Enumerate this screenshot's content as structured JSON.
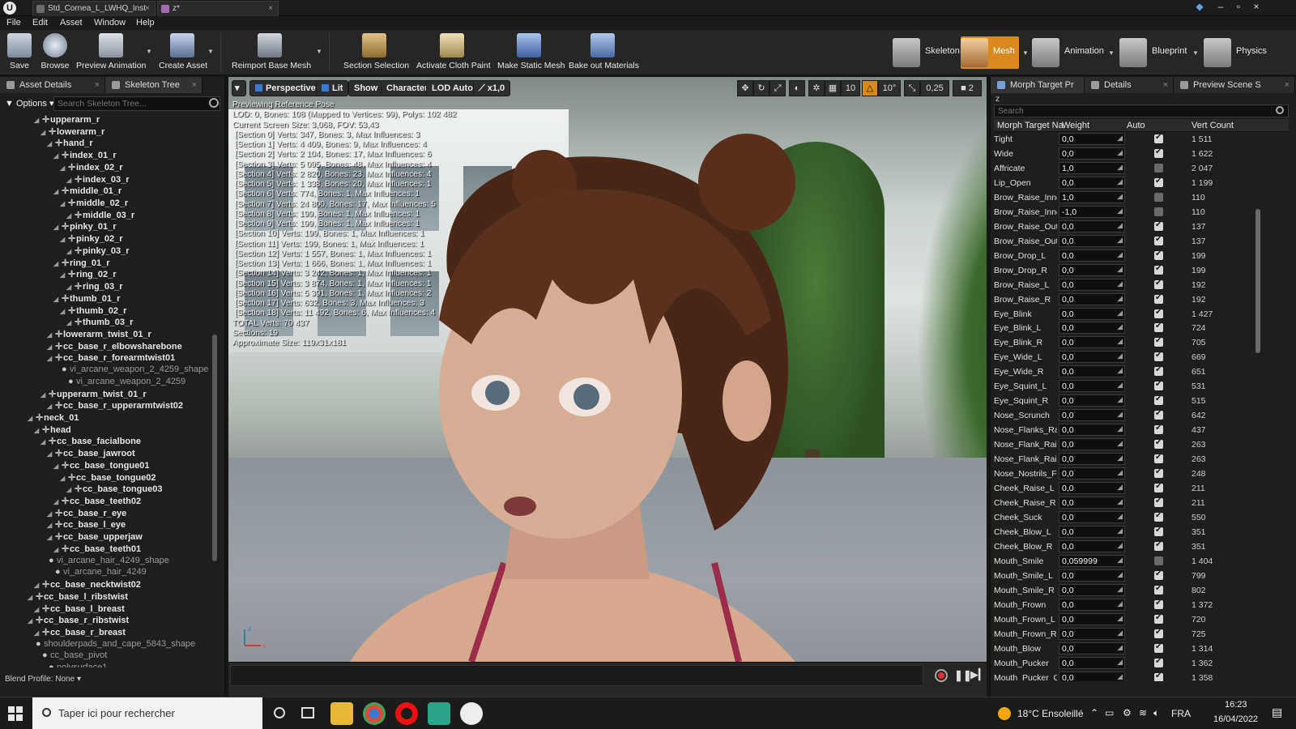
{
  "titlebar": {
    "tabs": [
      {
        "label": "Std_Cornea_L_LWHQ_Inst"
      },
      {
        "label": "z*"
      }
    ]
  },
  "menu": [
    "File",
    "Edit",
    "Asset",
    "Window",
    "Help"
  ],
  "toolbar": {
    "buttons": [
      "Save",
      "Browse",
      "Preview Animation",
      "Create Asset",
      "Reimport Base Mesh",
      "Section Selection",
      "Activate Cloth Paint",
      "Make Static Mesh",
      "Bake out Materials"
    ],
    "modes": [
      "Skeleton",
      "Mesh",
      "Animation",
      "Blueprint",
      "Physics"
    ]
  },
  "left_panel": {
    "tabs": [
      "Asset Details",
      "Skeleton Tree"
    ],
    "options_label": "Options",
    "search_placeholder": "Search Skeleton Tree...",
    "tree": [
      {
        "label": "upperarm_r",
        "depth": 4,
        "shape": false
      },
      {
        "label": "lowerarm_r",
        "depth": 5,
        "shape": false
      },
      {
        "label": "hand_r",
        "depth": 6,
        "shape": false
      },
      {
        "label": "index_01_r",
        "depth": 7,
        "shape": false
      },
      {
        "label": "index_02_r",
        "depth": 8,
        "shape": false
      },
      {
        "label": "index_03_r",
        "depth": 9,
        "shape": false
      },
      {
        "label": "middle_01_r",
        "depth": 7,
        "shape": false
      },
      {
        "label": "middle_02_r",
        "depth": 8,
        "shape": false
      },
      {
        "label": "middle_03_r",
        "depth": 9,
        "shape": false
      },
      {
        "label": "pinky_01_r",
        "depth": 7,
        "shape": false
      },
      {
        "label": "pinky_02_r",
        "depth": 8,
        "shape": false
      },
      {
        "label": "pinky_03_r",
        "depth": 9,
        "shape": false
      },
      {
        "label": "ring_01_r",
        "depth": 7,
        "shape": false
      },
      {
        "label": "ring_02_r",
        "depth": 8,
        "shape": false
      },
      {
        "label": "ring_03_r",
        "depth": 9,
        "shape": false
      },
      {
        "label": "thumb_01_r",
        "depth": 7,
        "shape": false
      },
      {
        "label": "thumb_02_r",
        "depth": 8,
        "shape": false
      },
      {
        "label": "thumb_03_r",
        "depth": 9,
        "shape": false
      },
      {
        "label": "lowerarm_twist_01_r",
        "depth": 6,
        "shape": false
      },
      {
        "label": "cc_base_r_elbowsharebone",
        "depth": 6,
        "shape": false
      },
      {
        "label": "cc_base_r_forearmtwist01",
        "depth": 6,
        "shape": false
      },
      {
        "label": "vi_arcane_weapon_2_4259_shape",
        "depth": 7,
        "shape": true
      },
      {
        "label": "vi_arcane_weapon_2_4259",
        "depth": 8,
        "shape": true
      },
      {
        "label": "upperarm_twist_01_r",
        "depth": 5,
        "shape": false
      },
      {
        "label": "cc_base_r_upperarmtwist02",
        "depth": 6,
        "shape": false
      },
      {
        "label": "neck_01",
        "depth": 3,
        "shape": false
      },
      {
        "label": "head",
        "depth": 4,
        "shape": false
      },
      {
        "label": "cc_base_facialbone",
        "depth": 5,
        "shape": false
      },
      {
        "label": "cc_base_jawroot",
        "depth": 6,
        "shape": false
      },
      {
        "label": "cc_base_tongue01",
        "depth": 7,
        "shape": false
      },
      {
        "label": "cc_base_tongue02",
        "depth": 8,
        "shape": false
      },
      {
        "label": "cc_base_tongue03",
        "depth": 9,
        "shape": false
      },
      {
        "label": "cc_base_teeth02",
        "depth": 7,
        "shape": false
      },
      {
        "label": "cc_base_r_eye",
        "depth": 6,
        "shape": false
      },
      {
        "label": "cc_base_l_eye",
        "depth": 6,
        "shape": false
      },
      {
        "label": "cc_base_upperjaw",
        "depth": 6,
        "shape": false
      },
      {
        "label": "cc_base_teeth01",
        "depth": 7,
        "shape": false
      },
      {
        "label": "vi_arcane_hair_4249_shape",
        "depth": 5,
        "shape": true
      },
      {
        "label": "vi_arcane_hair_4249",
        "depth": 6,
        "shape": true
      },
      {
        "label": "cc_base_necktwist02",
        "depth": 4,
        "shape": false
      },
      {
        "label": "cc_base_l_ribstwist",
        "depth": 3,
        "shape": false
      },
      {
        "label": "cc_base_l_breast",
        "depth": 4,
        "shape": false
      },
      {
        "label": "cc_base_r_ribstwist",
        "depth": 3,
        "shape": false
      },
      {
        "label": "cc_base_r_breast",
        "depth": 4,
        "shape": false
      },
      {
        "label": "shoulderpads_and_cape_5843_shape",
        "depth": 3,
        "shape": true
      },
      {
        "label": "cc_base_pivot",
        "depth": 4,
        "shape": true
      },
      {
        "label": "polysurface1",
        "depth": 5,
        "shape": true
      }
    ],
    "blend_profile": "Blend Profile: None"
  },
  "viewport": {
    "toolbar_left": [
      "Perspective",
      "Lit",
      "Show",
      "Character",
      "LOD Auto",
      "x1,0"
    ],
    "toolbar_right": [
      "10",
      "10°",
      "0,25",
      "2"
    ],
    "stats": [
      "Previewing Reference Pose",
      "LOD: 0, Bones: 108 (Mapped to Vertices: 99), Polys: 102 482",
      "Current Screen Size: 3,068, FOV: 53,43",
      "[Section 0] Verts: 347, Bones: 3, Max Influences: 3",
      "[Section 1] Verts: 4 409, Bones: 9, Max Influences: 4",
      "[Section 2] Verts: 2 104, Bones: 17, Max Influences: 6",
      "[Section 3] Verts: 5 095, Bones: 48, Max Influences: 4",
      "[Section 4] Verts: 2 820, Bones: 23, Max Influences: 4",
      "[Section 5] Verts: 1 338, Bones: 20, Max Influences: 1",
      "[Section 6] Verts: 774, Bones: 1, Max Influences: 1",
      "[Section 7] Verts: 24 800, Bones: 17, Max Influences: 5",
      "[Section 8] Verts: 199, Bones: 1, Max Influences: 1",
      "[Section 9] Verts: 199, Bones: 1, Max Influences: 1",
      "[Section 10] Verts: 199, Bones: 1, Max Influences: 1",
      "[Section 11] Verts: 199, Bones: 1, Max Influences: 1",
      "[Section 12] Verts: 1 557, Bones: 1, Max Influences: 1",
      "[Section 13] Verts: 1 666, Bones: 1, Max Influences: 1",
      "[Section 14] Verts: 3 242, Bones: 1, Max Influences: 1",
      "[Section 15] Verts: 3 874, Bones: 1, Max Influences: 1",
      "[Section 16] Verts: 5 391, Bones: 1, Max Influences: 2",
      "[Section 17] Verts: 632, Bones: 3, Max Influences: 3",
      "[Section 18] Verts: 11 492, Bones: 6, Max Influences: 4",
      "TOTAL Verts: 70 437",
      "Sections: 19",
      "Approximate Size: 119x31x181"
    ],
    "axis_labels": [
      "z",
      "x"
    ]
  },
  "right_panel": {
    "tabs": [
      "Morph Target Pr",
      "Details",
      "Preview Scene S"
    ],
    "filter_text": "z",
    "search_placeholder": "Search",
    "columns": [
      "Morph Target Na",
      "Weight",
      "Auto",
      "Vert Count"
    ],
    "rows": [
      {
        "name": "Tight",
        "weight": "0,0",
        "auto": true,
        "verts": "1 511"
      },
      {
        "name": "Wide",
        "weight": "0,0",
        "auto": true,
        "verts": "1 622"
      },
      {
        "name": "Affricate",
        "weight": "1,0",
        "auto": false,
        "verts": "2 047"
      },
      {
        "name": "Lip_Open",
        "weight": "0,0",
        "auto": true,
        "verts": "1 199"
      },
      {
        "name": "Brow_Raise_Inner",
        "weight": "1,0",
        "auto": false,
        "verts": "110"
      },
      {
        "name": "Brow_Raise_Inner",
        "weight": "-1,0",
        "auto": false,
        "verts": "110"
      },
      {
        "name": "Brow_Raise_Outer",
        "weight": "0,0",
        "auto": true,
        "verts": "137"
      },
      {
        "name": "Brow_Raise_Outer",
        "weight": "0,0",
        "auto": true,
        "verts": "137"
      },
      {
        "name": "Brow_Drop_L",
        "weight": "0,0",
        "auto": true,
        "verts": "199"
      },
      {
        "name": "Brow_Drop_R",
        "weight": "0,0",
        "auto": true,
        "verts": "199"
      },
      {
        "name": "Brow_Raise_L",
        "weight": "0,0",
        "auto": true,
        "verts": "192"
      },
      {
        "name": "Brow_Raise_R",
        "weight": "0,0",
        "auto": true,
        "verts": "192"
      },
      {
        "name": "Eye_Blink",
        "weight": "0,0",
        "auto": true,
        "verts": "1 427"
      },
      {
        "name": "Eye_Blink_L",
        "weight": "0,0",
        "auto": true,
        "verts": "724"
      },
      {
        "name": "Eye_Blink_R",
        "weight": "0,0",
        "auto": true,
        "verts": "705"
      },
      {
        "name": "Eye_Wide_L",
        "weight": "0,0",
        "auto": true,
        "verts": "669"
      },
      {
        "name": "Eye_Wide_R",
        "weight": "0,0",
        "auto": true,
        "verts": "651"
      },
      {
        "name": "Eye_Squint_L",
        "weight": "0,0",
        "auto": true,
        "verts": "531"
      },
      {
        "name": "Eye_Squint_R",
        "weight": "0,0",
        "auto": true,
        "verts": "515"
      },
      {
        "name": "Nose_Scrunch",
        "weight": "0,0",
        "auto": true,
        "verts": "642"
      },
      {
        "name": "Nose_Flanks_Raise",
        "weight": "0,0",
        "auto": true,
        "verts": "437"
      },
      {
        "name": "Nose_Flank_Raise",
        "weight": "0,0",
        "auto": true,
        "verts": "263"
      },
      {
        "name": "Nose_Flank_Raise",
        "weight": "0,0",
        "auto": true,
        "verts": "263"
      },
      {
        "name": "Nose_Nostrils_Flare",
        "weight": "0,0",
        "auto": true,
        "verts": "248"
      },
      {
        "name": "Cheek_Raise_L",
        "weight": "0,0",
        "auto": true,
        "verts": "211"
      },
      {
        "name": "Cheek_Raise_R",
        "weight": "0,0",
        "auto": true,
        "verts": "211"
      },
      {
        "name": "Cheek_Suck",
        "weight": "0,0",
        "auto": true,
        "verts": "550"
      },
      {
        "name": "Cheek_Blow_L",
        "weight": "0,0",
        "auto": true,
        "verts": "351"
      },
      {
        "name": "Cheek_Blow_R",
        "weight": "0,0",
        "auto": true,
        "verts": "351"
      },
      {
        "name": "Mouth_Smile",
        "weight": "0,059999",
        "auto": false,
        "verts": "1 404"
      },
      {
        "name": "Mouth_Smile_L",
        "weight": "0,0",
        "auto": true,
        "verts": "799"
      },
      {
        "name": "Mouth_Smile_R",
        "weight": "0,0",
        "auto": true,
        "verts": "802"
      },
      {
        "name": "Mouth_Frown",
        "weight": "0,0",
        "auto": true,
        "verts": "1 372"
      },
      {
        "name": "Mouth_Frown_L",
        "weight": "0,0",
        "auto": true,
        "verts": "720"
      },
      {
        "name": "Mouth_Frown_R",
        "weight": "0,0",
        "auto": true,
        "verts": "725"
      },
      {
        "name": "Mouth_Blow",
        "weight": "0,0",
        "auto": true,
        "verts": "1 314"
      },
      {
        "name": "Mouth_Pucker",
        "weight": "0,0",
        "auto": true,
        "verts": "1 362"
      },
      {
        "name": "Mouth_Pucker_Open",
        "weight": "0,0",
        "auto": true,
        "verts": "1 358"
      }
    ]
  },
  "taskbar": {
    "search_placeholder": "Taper ici pour rechercher",
    "weather": "18°C Ensoleillé",
    "lang": "FRA",
    "time": "16:23",
    "date": "16/04/2022"
  }
}
